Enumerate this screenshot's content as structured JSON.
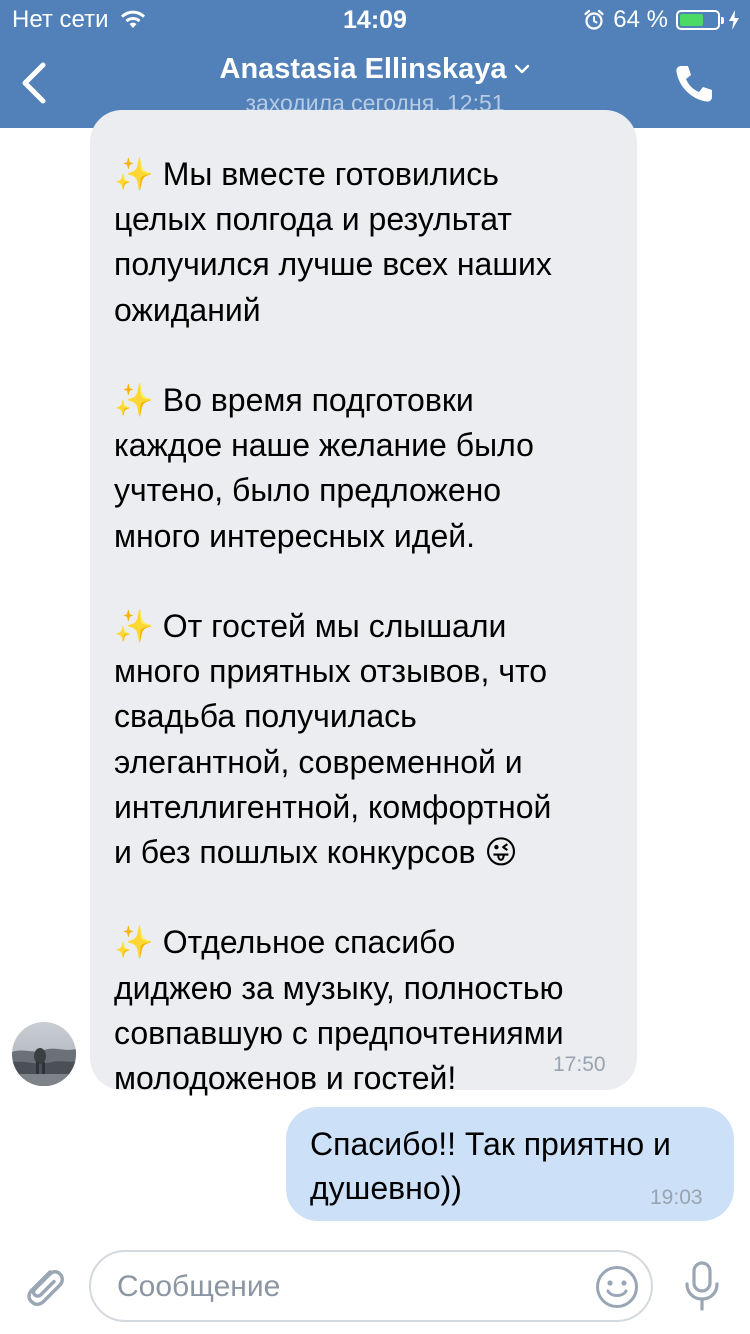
{
  "status_bar": {
    "carrier": "Нет сети",
    "time": "14:09",
    "battery_percent_label": "64 %",
    "battery_level": 0.64,
    "battery_color": "#4cd964"
  },
  "header": {
    "contact_name": "Anastasia Ellinskaya",
    "last_seen": "заходила сегодня, 12:51",
    "back_icon": "chevron-left-icon",
    "call_icon": "phone-icon",
    "background_color": "#5181b8"
  },
  "messages": [
    {
      "direction": "incoming",
      "text": "✨ Мы вместе готовились\nцелых полгода и результат\nполучился лучше всех наших\nожиданий\n\n✨ Во время подготовки\nкаждое наше желание было\nучтено, было предложено\nмного интересных идей.\n\n✨ От гостей мы слышали\nмного приятных отзывов, что\nсвадьба получилась\nэлегантной, современной и\nинтеллигентной, комфортной\nи без пошлых конкурсов 😜\n\n✨ Отдельное спасибо\nдиджею за музыку, полностью\nсовпавшую с предпочтениями\nмолодоженов и гостей!",
      "time": "17:50",
      "bubble_color": "#ebedf0"
    },
    {
      "direction": "outgoing",
      "text": "Спасибо!! Так приятно и\nдушевно))",
      "time": "19:03",
      "bubble_color": "#cce0f8"
    }
  ],
  "composer": {
    "placeholder": "Сообщение",
    "attach_icon": "paperclip-icon",
    "emoji_icon": "smiley-icon",
    "mic_icon": "microphone-icon"
  }
}
